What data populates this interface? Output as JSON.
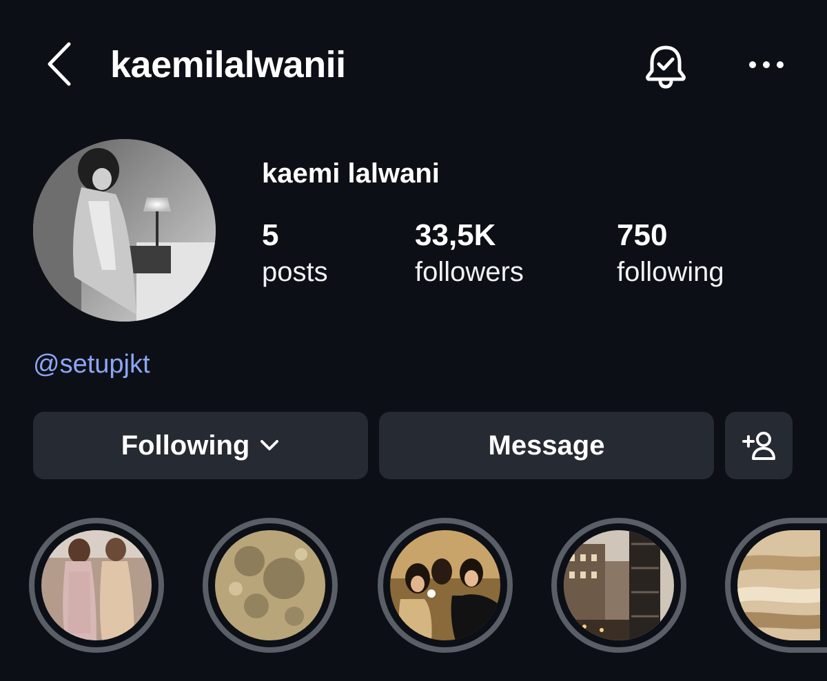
{
  "header": {
    "username": "kaemilalwanii",
    "back_icon": "chevron-left-icon",
    "bell_icon": "bell-check-icon",
    "more_icon": "more-dots-icon"
  },
  "profile": {
    "display_name": "kaemi lalwani",
    "stats": [
      {
        "value": "5",
        "label": "posts"
      },
      {
        "value": "33,5K",
        "label": "followers"
      },
      {
        "value": "750",
        "label": "following"
      }
    ],
    "bio_link": "@setupjkt",
    "link_color": "#8ea6f5"
  },
  "actions": {
    "following_label": "Following",
    "message_label": "Message",
    "add_icon": "add-person-icon"
  },
  "highlights": [
    {
      "name": "highlight-dresses"
    },
    {
      "name": "highlight-moon"
    },
    {
      "name": "highlight-party"
    },
    {
      "name": "highlight-city"
    },
    {
      "name": "highlight-planet"
    }
  ],
  "colors": {
    "background": "#0c1016",
    "button": "#262a32",
    "highlight_ring": "#5a5e66"
  }
}
